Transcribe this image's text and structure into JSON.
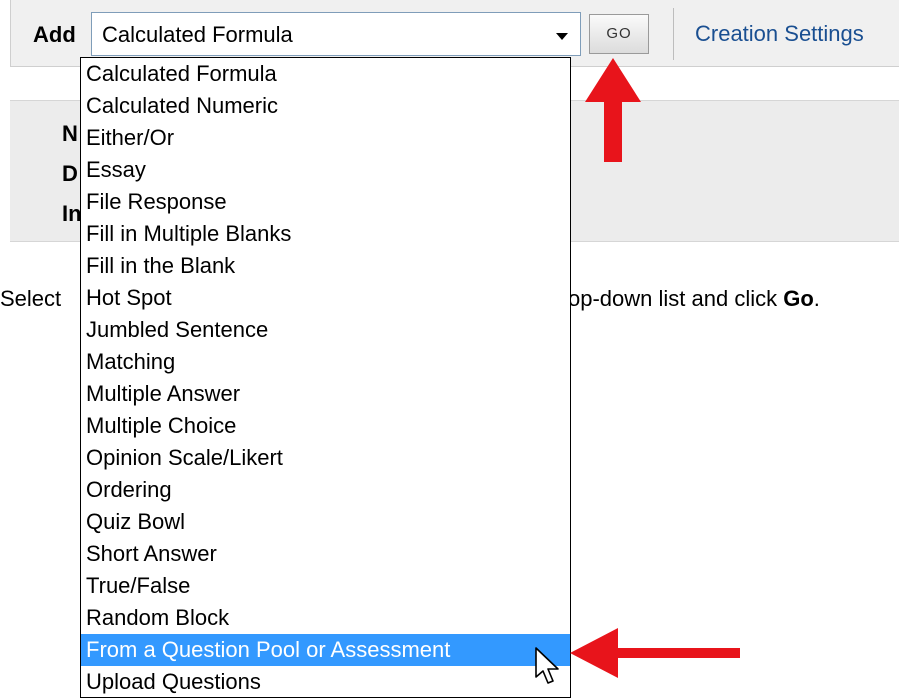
{
  "toolbar": {
    "add_label": "Add",
    "select_value": "Calculated Formula",
    "go_label": "GO",
    "creation_settings": "Creation Settings"
  },
  "info": {
    "line1": "N",
    "line2": "D",
    "line3": "In"
  },
  "instructions": {
    "left": "Select",
    "right_prefix": "op-down list and click ",
    "right_bold": "Go",
    "right_suffix": "."
  },
  "dropdown": {
    "options": [
      "Calculated Formula",
      "Calculated Numeric",
      "Either/Or",
      "Essay",
      "File Response",
      "Fill in Multiple Blanks",
      "Fill in the Blank",
      "Hot Spot",
      "Jumbled Sentence",
      "Matching",
      "Multiple Answer",
      "Multiple Choice",
      "Opinion Scale/Likert",
      "Ordering",
      "Quiz Bowl",
      "Short Answer",
      "True/False",
      "Random Block",
      "From a Question Pool or Assessment",
      "Upload Questions"
    ],
    "highlighted": "From a Question Pool or Assessment"
  },
  "colors": {
    "highlight": "#3399ff",
    "annotation_arrow": "#e8141b",
    "link": "#1a4f91"
  }
}
